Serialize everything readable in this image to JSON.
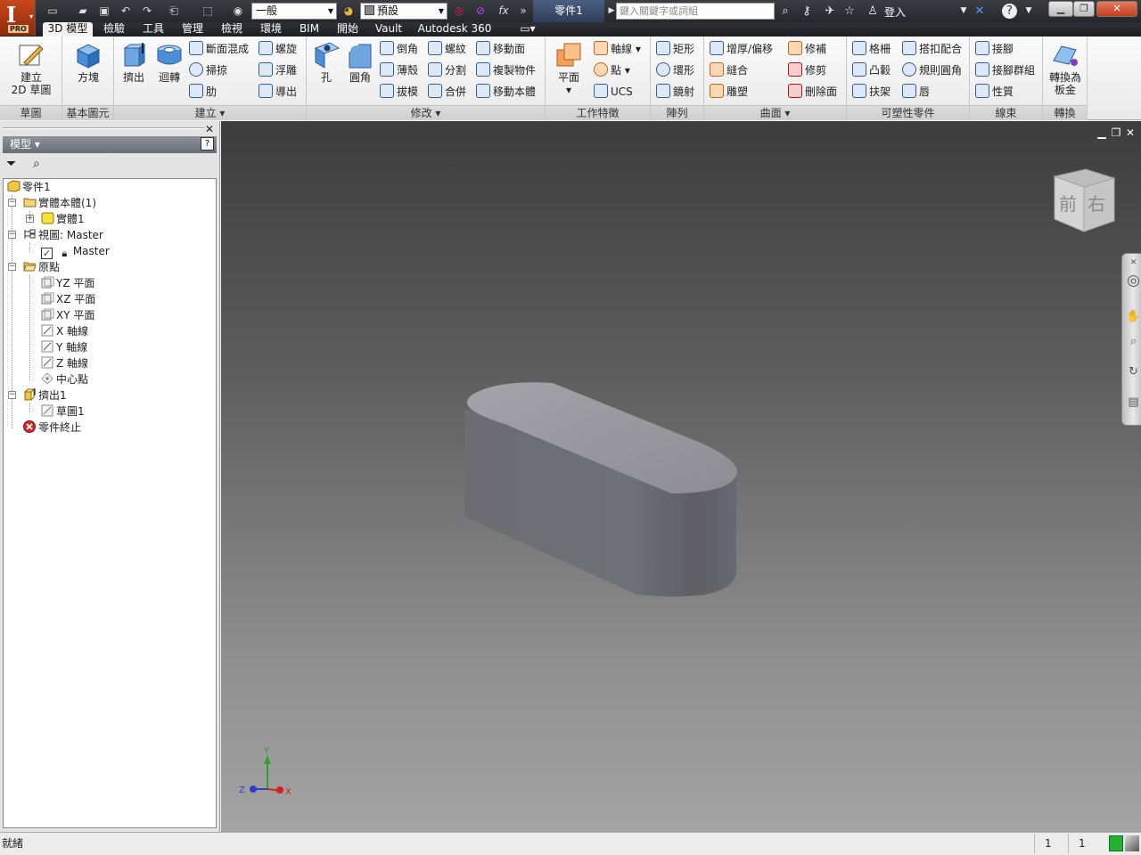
{
  "titlebar": {
    "app_logo": "I",
    "app_edition": "PRO",
    "material_value": "一般",
    "appearance_value": "預設",
    "fx_label": "fx",
    "document_tab": "零件1",
    "help_search_placeholder": "鍵入關鍵字或詞組",
    "login_label": "登入"
  },
  "ribbon_tabs": [
    {
      "label": "3D 模型"
    },
    {
      "label": "檢驗"
    },
    {
      "label": "工具"
    },
    {
      "label": "管理"
    },
    {
      "label": "檢視"
    },
    {
      "label": "環境"
    },
    {
      "label": "BIM"
    },
    {
      "label": "開始"
    },
    {
      "label": "Vault"
    },
    {
      "label": "Autodesk 360"
    }
  ],
  "ribbon": {
    "sketch": {
      "title": "草圖",
      "create_2d_sketch_line1": "建立",
      "create_2d_sketch_line2": "2D 草圖"
    },
    "primitives": {
      "title": "基本圖元",
      "box": "方塊"
    },
    "create": {
      "title": "建立",
      "extrude": "擠出",
      "revolve": "迴轉",
      "loft": "斷面混成",
      "sweep": "掃掠",
      "rib": "肋",
      "coil": "螺旋",
      "emboss": "浮雕",
      "derive": "導出"
    },
    "modify": {
      "title": "修改",
      "hole": "孔",
      "fillet": "圓角",
      "chamfer": "倒角",
      "shell": "薄殼",
      "draft": "拔模",
      "thread": "螺紋",
      "split": "分割",
      "combine": "合併",
      "move_face": "移動面",
      "copy_object": "複製物件",
      "move_bodies": "移動本體"
    },
    "work_features": {
      "title": "工作特徵",
      "plane": "平面",
      "axis": "軸線",
      "point": "點",
      "ucs": "UCS"
    },
    "pattern": {
      "title": "陣列",
      "rectangular": "矩形",
      "circular": "環形",
      "mirror": "鏡射"
    },
    "surface": {
      "title": "曲面",
      "thicken": "增厚/偏移",
      "stitch": "縫合",
      "sculpt": "雕塑",
      "patch": "修補",
      "trim": "修剪",
      "delete_face": "刪除面"
    },
    "plastic_part": {
      "title": "可塑性零件",
      "grill": "格柵",
      "boss": "凸轂",
      "rest": "扶架",
      "snap_fit": "搭扣配合",
      "rule_fillet": "規則圓角",
      "lip": "唇"
    },
    "harness": {
      "title": "線束",
      "lace": "接腳",
      "lace_group": "接腳群組",
      "properties": "性質"
    },
    "convert": {
      "title": "轉換",
      "to_sheet_metal_line1": "轉換為",
      "to_sheet_metal_line2": "板金"
    }
  },
  "browser": {
    "header": "模型",
    "help": "?",
    "tree": [
      {
        "label": "零件1"
      },
      {
        "label": "實體本體(1)"
      },
      {
        "label": "實體1"
      },
      {
        "label": "視圖: Master"
      },
      {
        "label": "Master"
      },
      {
        "label": "原點"
      },
      {
        "label": "YZ 平面"
      },
      {
        "label": "XZ 平面"
      },
      {
        "label": "XY 平面"
      },
      {
        "label": "X 軸線"
      },
      {
        "label": "Y 軸線"
      },
      {
        "label": "Z 軸線"
      },
      {
        "label": "中心點"
      },
      {
        "label": "擠出1"
      },
      {
        "label": "草圖1"
      },
      {
        "label": "零件終止"
      }
    ]
  },
  "viewcube": {
    "front": "前",
    "right": "右"
  },
  "triad": {
    "x": "X",
    "y": "Y",
    "z": "Z"
  },
  "status": {
    "text": "就緒",
    "count1": "1",
    "count2": "1"
  },
  "colors": {
    "accent": "#c9471c",
    "title_bar": "#2b2e33",
    "active_tab": "#f3f3f3",
    "model_gray": "#7a7a80"
  }
}
